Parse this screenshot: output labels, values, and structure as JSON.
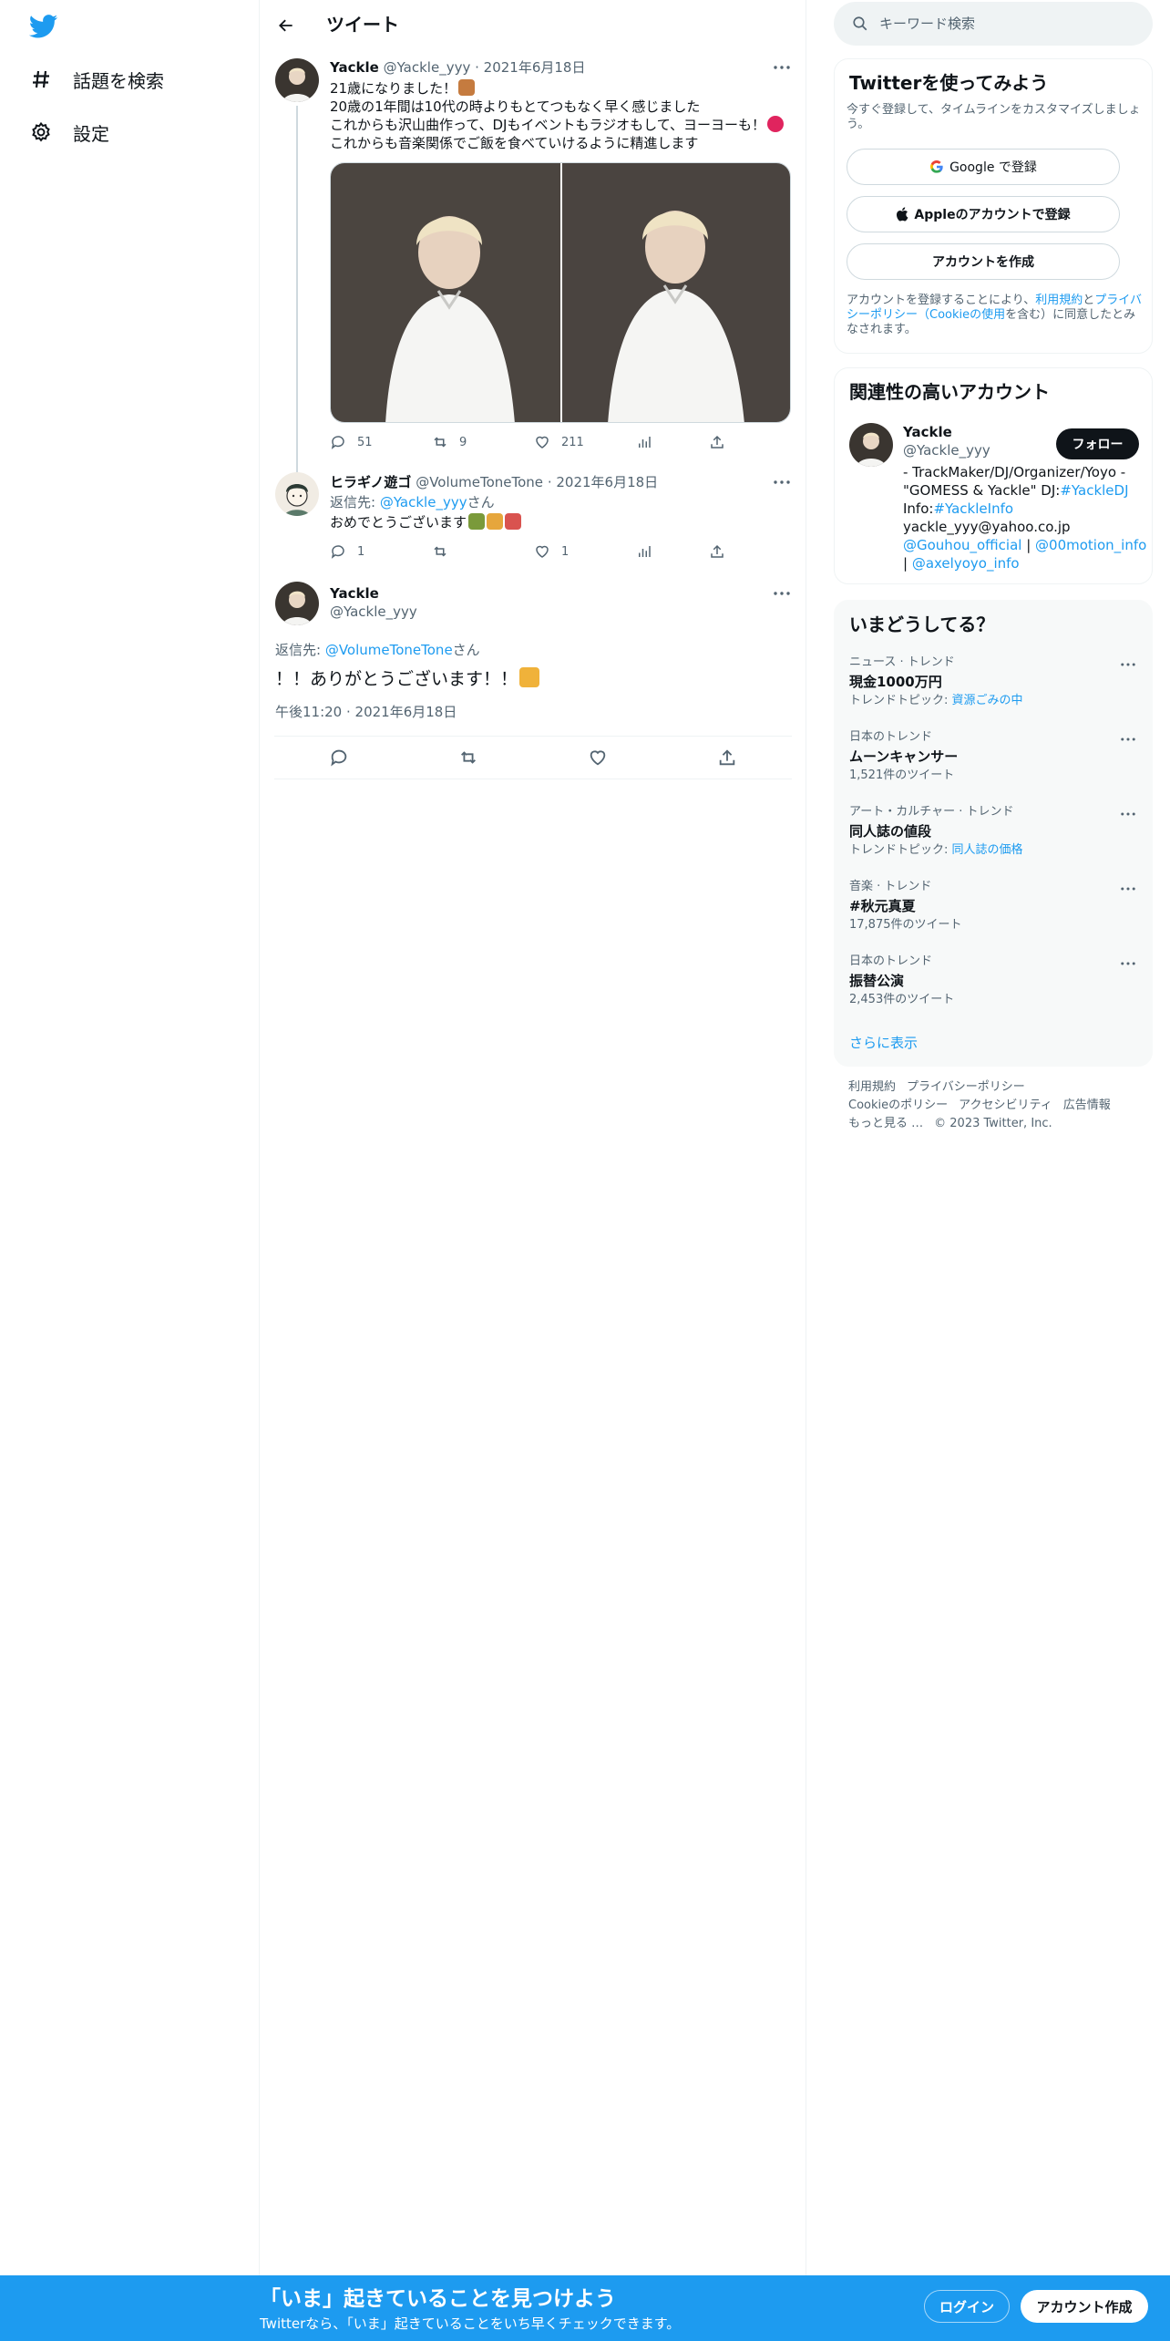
{
  "colors": {
    "accent": "#1d9bf0",
    "text": "#0f1419",
    "muted": "#536471",
    "border": "#eff3f4",
    "button_dark": "#0f1419"
  },
  "nav": {
    "logo_icon": "twitter-bird-icon",
    "items": [
      {
        "label": "話題を検索",
        "icon": "hashtag-icon"
      },
      {
        "label": "設定",
        "icon": "gear-icon"
      }
    ]
  },
  "main": {
    "title": "ツイート",
    "tweet1": {
      "name": "Yackle",
      "handle": "@Yackle_yyy",
      "date": "2021年6月18日",
      "lines": [
        "21歳になりました！",
        "20歳の1年間は10代の時よりもとてつもなく早く感じました",
        "これからも沢山曲作って、DJもイベントもラジオもして、ヨーヨーも！",
        "これからも音楽関係でご飯を食べていけるように精進します"
      ],
      "replies": "51",
      "retweets": "9",
      "likes": "211"
    },
    "tweet2": {
      "name": "ヒラギノ遊ゴ",
      "handle": "@VolumeToneTone",
      "date": "2021年6月18日",
      "reply_prefix": "返信先: ",
      "reply_to": "@Yackle_yyy",
      "reply_suffix": "さん",
      "text": "おめでとうございます",
      "replies": "1",
      "likes": "1"
    },
    "focused": {
      "name": "Yackle",
      "handle": "@Yackle_yyy",
      "reply_prefix": "返信先: ",
      "reply_to": "@VolumeToneTone",
      "reply_suffix": "さん",
      "text": "！！ありがとうございます！！",
      "time": "午後11:20",
      "date": "2021年6月18日"
    }
  },
  "right": {
    "search_placeholder": "キーワード検索",
    "signup": {
      "title": "Twitterを使ってみよう",
      "desc": "今すぐ登録して、タイムラインをカスタマイズしましょう。",
      "google": "Google で登録",
      "apple": "Appleのアカウントで登録",
      "create": "アカウントを作成",
      "legal_1": "アカウントを登録することにより、",
      "terms": "利用規約",
      "and": "と",
      "privacy": "プライバシーポリシー（Cookieの使用",
      "legal_2": "を含む）に同意したとみなされます。"
    },
    "related": {
      "title": "関連性の高いアカウント",
      "name": "Yackle",
      "handle": "@Yackle_yyy",
      "follow": "フォロー",
      "bio_1": "- TrackMaker/DJ/Organizer/Yoyo -",
      "bio_2": "\"GOMESS & Yackle\" DJ:",
      "bio_2_link": "#YackleDJ",
      "bio_3": "Info:",
      "bio_3_link": "#YackleInfo",
      "bio_4": "yackle_yyy@yahoo.co.jp",
      "bio_5_link1": "@Gouhou_official",
      "bio_5_sep": " | ",
      "bio_5_link2": "@00motion_info",
      "bio_6_sep": "| ",
      "bio_6_link": "@axelyoyo_info"
    },
    "trends": {
      "title": "いまどうしてる？",
      "items": [
        {
          "category": "ニュース · トレンド",
          "name": "現金1000万円",
          "sub_prefix": "トレンドトピック: ",
          "sub_link": "資源ごみの中",
          "sub": ""
        },
        {
          "category": "日本のトレンド",
          "name": "ムーンキャンサー",
          "sub_prefix": "",
          "sub_link": "",
          "sub": "1,521件のツイート"
        },
        {
          "category": "アート・カルチャー · トレンド",
          "name": "同人誌の値段",
          "sub_prefix": "トレンドトピック: ",
          "sub_link": "同人誌の価格",
          "sub": ""
        },
        {
          "category": "音楽 · トレンド",
          "name": "#秋元真夏",
          "sub_prefix": "",
          "sub_link": "",
          "sub": "17,875件のツイート"
        },
        {
          "category": "日本のトレンド",
          "name": "振替公演",
          "sub_prefix": "",
          "sub_link": "",
          "sub": "2,453件のツイート"
        }
      ],
      "show_more": "さらに表示"
    },
    "footer": {
      "terms": "利用規約",
      "privacy": "プライバシーポリシー",
      "cookie": "Cookieのポリシー",
      "accessibility": "アクセシビリティ",
      "ads": "広告情報",
      "more": "もっと見る …",
      "copyright": "© 2023 Twitter, Inc."
    }
  },
  "bottom": {
    "title": "「いま」起きていることを見つけよう",
    "subtitle": "Twitterなら、「いま」起きていることをいち早くチェックできます。",
    "login": "ログイン",
    "signup": "アカウント作成"
  }
}
